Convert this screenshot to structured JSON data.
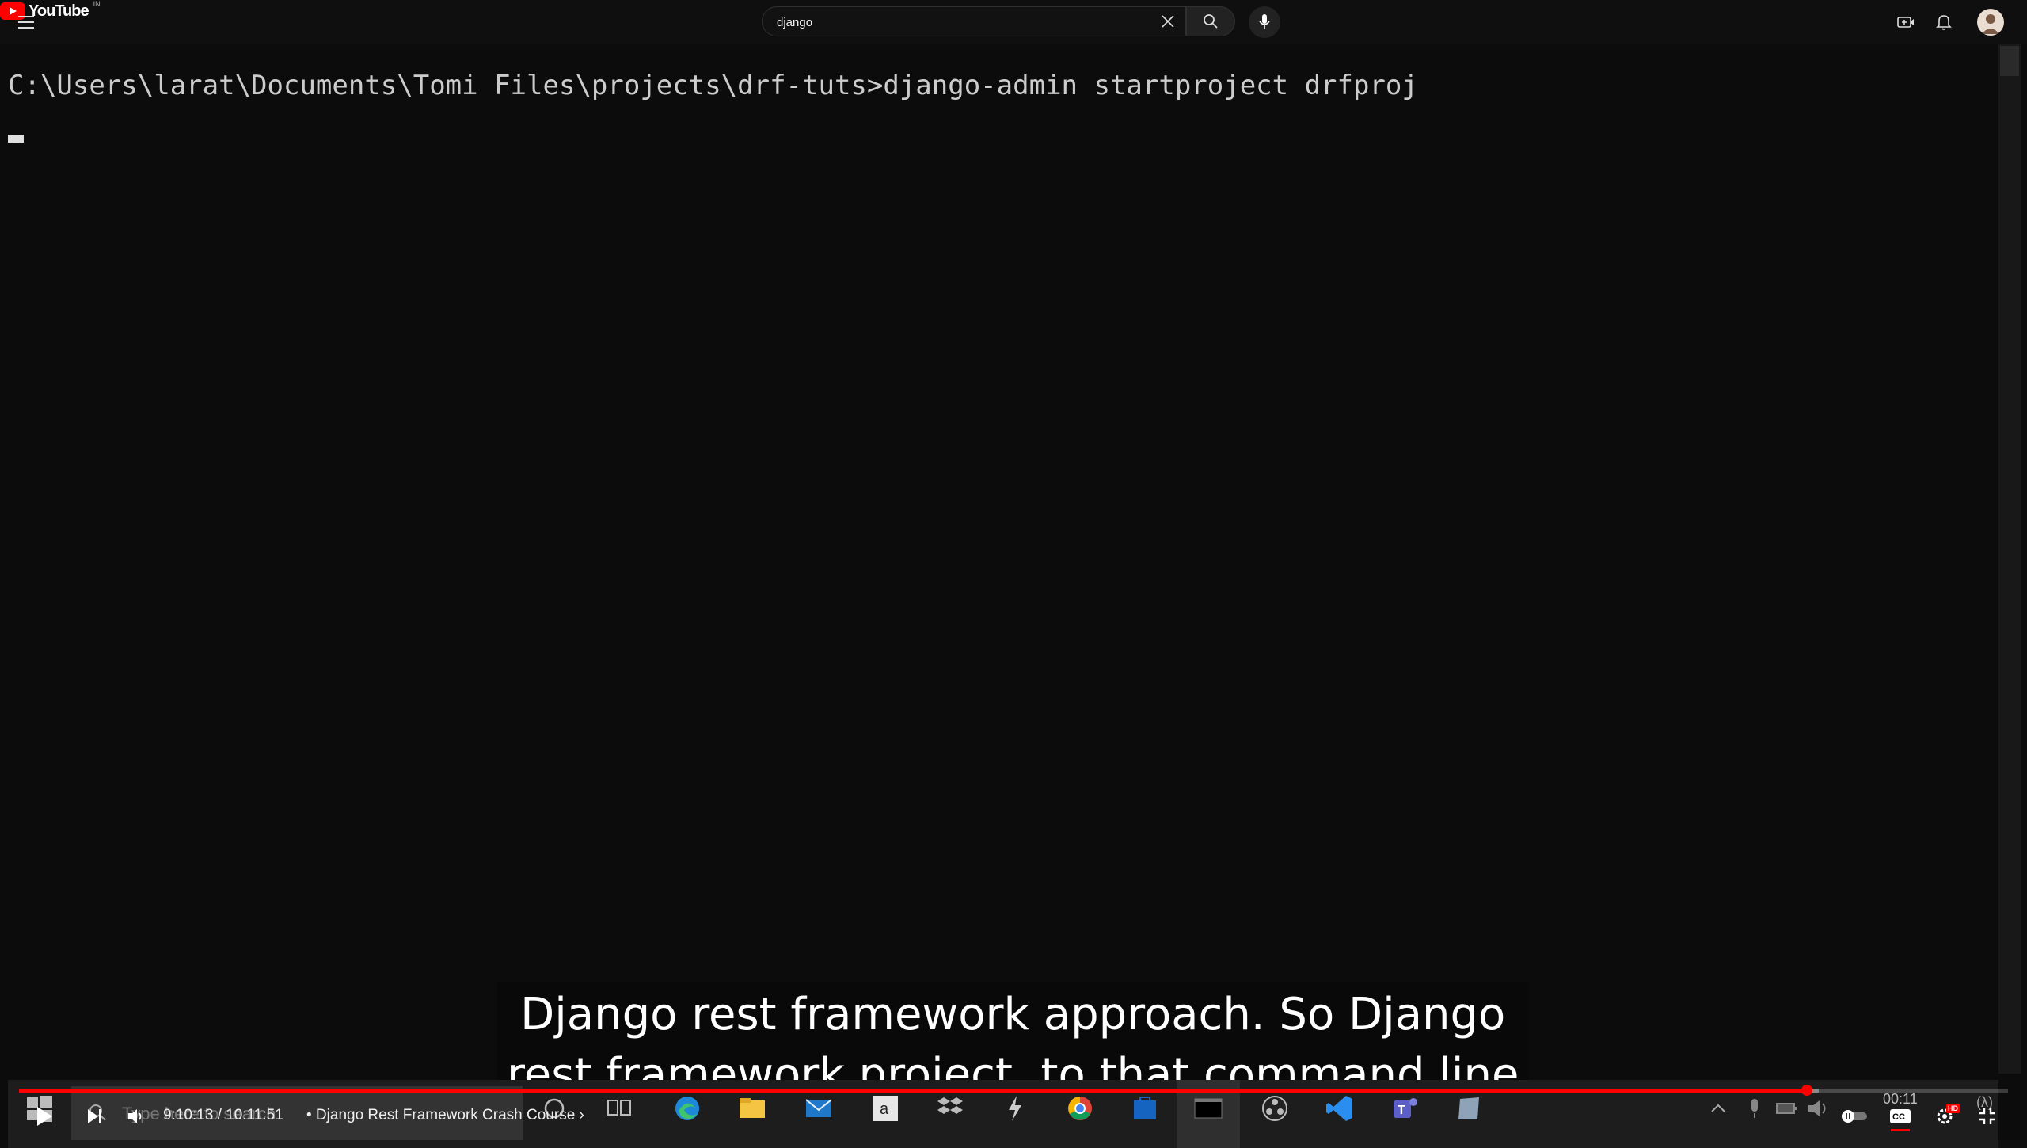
{
  "app": {
    "name": "YouTube",
    "country": "IN"
  },
  "search": {
    "query": "django"
  },
  "icons": {
    "menu": "hamburger-menu-icon",
    "search": "search-icon",
    "clear": "close-icon",
    "mic": "microphone-icon",
    "create": "create-video-icon",
    "notifications": "bell-icon"
  },
  "video": {
    "terminal_line": "C:\\Users\\larat\\Documents\\Tomi Files\\projects\\drf-tuts>django-admin startproject drfproj",
    "caption_line1": "Django rest framework approach. So Django",
    "caption_line2": "rest framework project, to that command line",
    "taskbar_search_placeholder": "Type here to search",
    "taskbar_clock": "00:11",
    "watermark": "(λ)"
  },
  "player": {
    "current_time": "9:10:13",
    "duration": "10:11:51",
    "time_display": "9:10:13 / 10:11:51",
    "chapter": "• Django Rest Framework Crash Course ›",
    "progress_fraction": 0.899,
    "buffered_fraction": 0.905,
    "hd_badge": "HD",
    "colors": {
      "accent": "#ff0000",
      "background": "#0f0f0f"
    }
  }
}
